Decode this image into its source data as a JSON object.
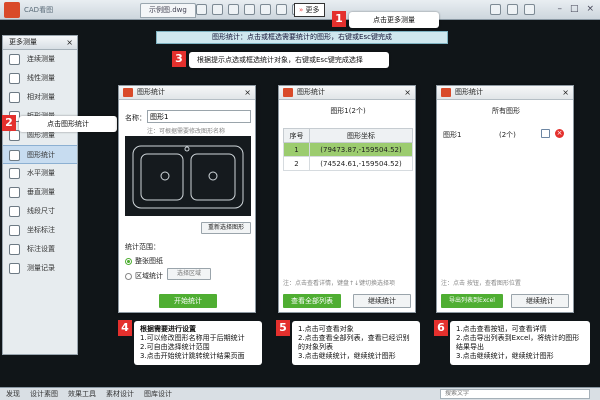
{
  "topbar": {
    "app_name": "CAD看图",
    "doc_tab": "示例图.dwg",
    "more_label": "更多"
  },
  "status_hint": "图形统计：点击或框选需要统计的图形，右键或Esc键完成",
  "callouts": {
    "c1": {
      "num": "1",
      "text": "点击更多测量"
    },
    "c2": {
      "num": "2",
      "text": "点击图形统计"
    },
    "c3": {
      "num": "3",
      "text": "根据提示点选或框选统计对象，右键或Esc键完成选择"
    }
  },
  "left_panel": {
    "title": "更多测量",
    "items": [
      {
        "label": "连续测量"
      },
      {
        "label": "线性测量"
      },
      {
        "label": "相对测量"
      },
      {
        "label": "矩形测量"
      },
      {
        "label": "圆形测量"
      },
      {
        "label": "图形统计"
      },
      {
        "label": "水平测量"
      },
      {
        "label": "垂直测量"
      },
      {
        "label": "线段尺寸"
      },
      {
        "label": "坐标标注"
      },
      {
        "label": "标注设置"
      },
      {
        "label": "测量记录"
      }
    ]
  },
  "dialog1": {
    "title": "图形统计",
    "name_label": "名称：",
    "name_value": "图形1",
    "note": "注：可根据需要修改图形名称",
    "reselect_btn": "重新选择图形",
    "range_label": "统计范围：",
    "option_all": "整张图纸",
    "option_region": "区域统计",
    "select_region_btn": "选择区域",
    "start_btn": "开始统计"
  },
  "dialog2": {
    "title": "图形统计",
    "heading": "图形1(2个)",
    "col_no": "序号",
    "col_coord": "图形坐标",
    "rows": [
      {
        "no": "1",
        "coord": "(79473.87,-159504.52)"
      },
      {
        "no": "2",
        "coord": "(74524.61,-159504.52)"
      }
    ],
    "note": "注：点击查看详情，键盘↑↓键切换选择项",
    "view_all_btn": "查看全部列表",
    "continue_btn": "继续统计"
  },
  "dialog3": {
    "title": "图形统计",
    "heading": "所有图形",
    "item_name": "图形1",
    "item_count": "(2个)",
    "note": "注：点击 按钮，查看图形位置",
    "export_btn": "导出列表到Excel",
    "continue_btn": "继续统计"
  },
  "instructions": {
    "i4": {
      "num": "4",
      "title": "根据需要进行设置",
      "lines": [
        "1.可以修改图形名称用于后期统计",
        "2.可自由选择统计范围",
        "3.点击开始统计跳转统计结果页面"
      ]
    },
    "i5": {
      "num": "5",
      "lines": [
        "1.点击可查看对象",
        "2.点击查看全部列表，查看已经识别的对象列表",
        "3.点击继续统计，继续统计图形"
      ]
    },
    "i6": {
      "num": "6",
      "lines": [
        "1.点击查看按钮，可查看详情",
        "2.点击导出列表到Excel，将统计的图形结果导出",
        "3.点击继续统计，继续统计图形"
      ]
    }
  },
  "bottombar": {
    "items": [
      "发现",
      "设计素图",
      "效果工具",
      "素材设计",
      "图库设计"
    ],
    "search_placeholder": "搜索文字"
  },
  "colors": {
    "callout_red": "#e4302d",
    "button_green": "#4fae32",
    "selected_row": "#9ccc6f"
  }
}
